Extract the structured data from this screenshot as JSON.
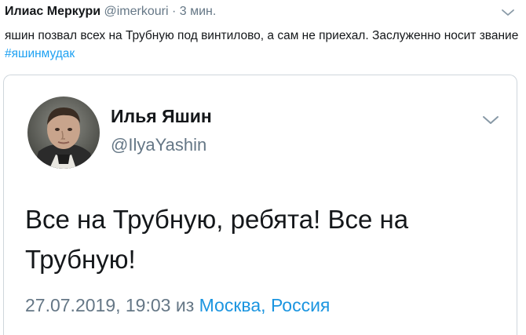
{
  "outer": {
    "name": "Илиас Меркури",
    "handle": "@imerkouri",
    "dot": "·",
    "time": "3 мин.",
    "text": "яшин позвал всех на Трубную под винтилово, а сам не приехал. Заслуженно носит звание ",
    "hashtag": "#яшинмудак"
  },
  "quoted": {
    "name": "Илья Яшин",
    "handle": "@IlyaYashin",
    "text": "Все на Трубную, ребята! Все на Трубную!",
    "datetime": "27.07.2019, 19:03",
    "from": "из",
    "location": "Москва, Россия"
  },
  "icons": {
    "outer_menu": "chevron-down-icon",
    "quoted_menu": "chevron-down-icon",
    "avatar": "profile-photo"
  },
  "colors": {
    "link": "#1da1f2",
    "secondary_text": "#657786",
    "border": "#cfd6dc"
  }
}
